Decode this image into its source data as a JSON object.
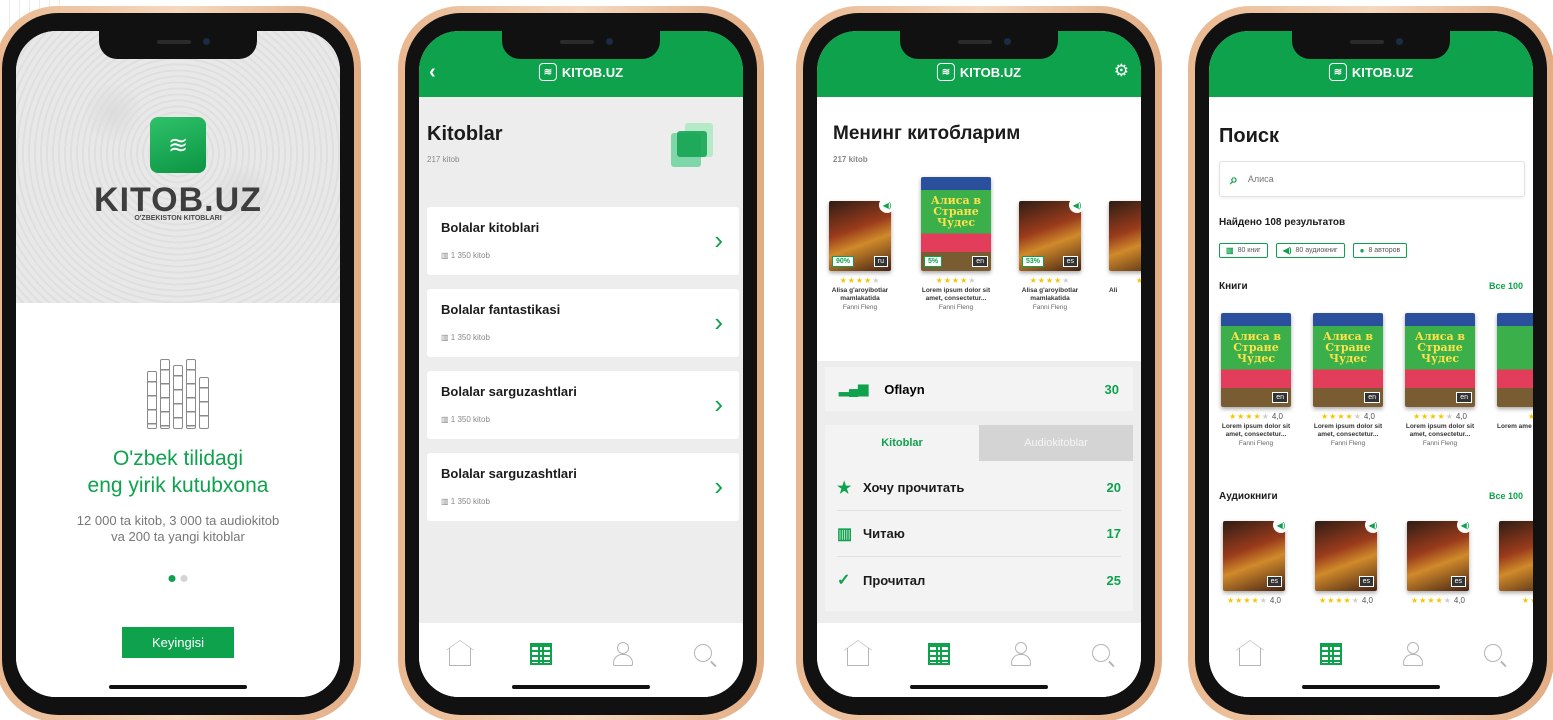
{
  "screen1": {
    "brand": "KITOB.UZ",
    "brand_sub": "O'ZBEKISTON KITOBLARI",
    "title_line1": "O'zbek tilidagi",
    "title_line2": "eng yirik kutubxona",
    "sub_line1": "12 000 ta kitob, 3 000 ta audiokitob",
    "sub_line2": "va 200 ta yangi kitoblar",
    "button": "Keyingisi"
  },
  "header": {
    "logo": "KITOB.UZ"
  },
  "screen2": {
    "title": "Kitoblar",
    "count": "217 kitob",
    "categories": [
      {
        "title": "Bolalar kitoblari",
        "count": "1 350 kitob"
      },
      {
        "title": "Bolalar fantastikasi",
        "count": "1 350 kitob"
      },
      {
        "title": "Bolalar sarguzashtlari",
        "count": "1 350 kitob"
      },
      {
        "title": "Bolalar sarguzashtlari",
        "count": "1 350 kitob"
      }
    ]
  },
  "screen3": {
    "title": "Менинг китобларим",
    "count": "217 kitob",
    "books": [
      {
        "title": "Alisa g'aroyibotlar mamlakatida",
        "author": "Fanni Fleng",
        "progress": "90%",
        "lang": "ru"
      },
      {
        "title": "Lorem ipsum dolor sit amet, consectetur...",
        "author": "Fanni Fleng",
        "progress": "5%",
        "lang": "en",
        "cover_title": "Алиса в Стране Чудес"
      },
      {
        "title": "Alisa g'aroyibotlar mamlakatida",
        "author": "Fanni Fleng",
        "progress": "53%",
        "lang": "es"
      },
      {
        "title": "Ali"
      }
    ],
    "offline": {
      "label": "Oflayn",
      "value": "30"
    },
    "tabs": {
      "active": "Kitoblar",
      "inactive": "Audiokitoblar"
    },
    "list": [
      {
        "label": "Хочу прочитать",
        "value": "20"
      },
      {
        "label": "Читаю",
        "value": "17"
      },
      {
        "label": "Прочитал",
        "value": "25"
      }
    ]
  },
  "screen4": {
    "title": "Поиск",
    "search_value": "Алиса",
    "found": "Найдено 108 результатов",
    "chips": [
      "80 книг",
      "80 аудиокниг",
      "8 авторов"
    ],
    "books_header": "Книги",
    "books_all": "Все 100",
    "audio_header": "Аудиокниги",
    "audio_all": "Все 100",
    "books": [
      {
        "title": "Lorem ipsum dolor sit amet, consectetur...",
        "author": "Fanni Fleng",
        "rating": "4,0",
        "lang": "en",
        "cover_title": "Алиса в Стране Чудес"
      },
      {
        "title": "Lorem ipsum dolor sit amet, consectetur...",
        "author": "Fanni Fleng",
        "rating": "4,0",
        "lang": "en",
        "cover_title": "Алиса в Стране Чудес"
      },
      {
        "title": "Lorem ipsum dolor sit amet, consectetur...",
        "author": "Fanni Fleng",
        "rating": "4,0",
        "lang": "en",
        "cover_title": "Алиса в Стране Чудес"
      },
      {
        "title": "Lorem ame"
      }
    ],
    "audio": [
      {
        "rating": "4,0",
        "lang": "es"
      },
      {
        "rating": "4,0",
        "lang": "es"
      },
      {
        "rating": "4,0",
        "lang": "es"
      }
    ]
  },
  "colors": {
    "accent": "#0ea24d",
    "frame": "#f1c7a4"
  }
}
